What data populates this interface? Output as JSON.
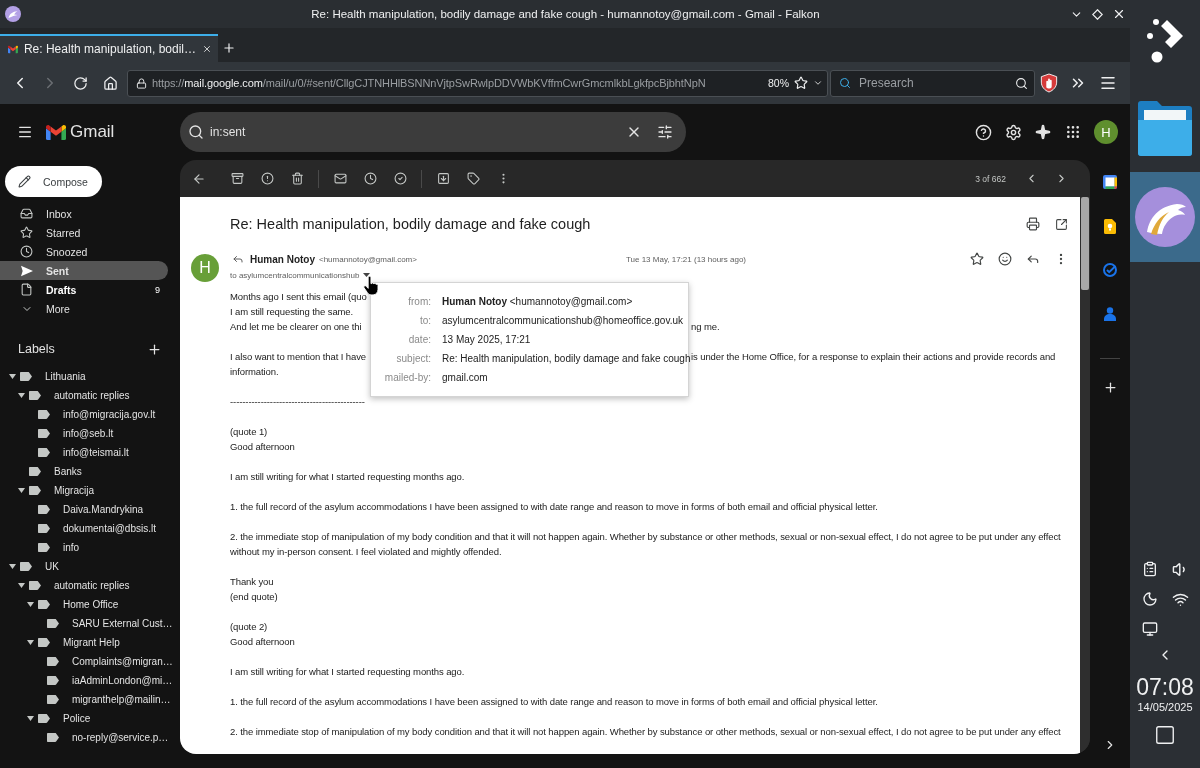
{
  "window": {
    "title": "Re: Health manipulation, bodily damage and fake cough - humannotoy@gmail.com - Gmail - Falkon"
  },
  "tabs": [
    {
      "label": "Re: Health manipulation, bodil…",
      "selected": true
    }
  ],
  "navigation": {
    "back_disabled": false,
    "forward_disabled": true,
    "url_scheme": "https://",
    "url_host": "mail.google.com",
    "url_path": "/mail/u/0/#sent/CllgCJTNHHlBSNNnVjtpSwRwlpDDVWbKVffmCwrGmcmlkbLgkfpcBjbhtNpN",
    "zoom": "80%",
    "search": {
      "placeholder": "Presearch"
    }
  },
  "gmail": {
    "brand": "Gmail",
    "search": {
      "value": "in:sent"
    },
    "account_initial": "H",
    "compose": "Compose",
    "nav": [
      {
        "label": "Inbox",
        "selected": false,
        "unread": false
      },
      {
        "label": "Starred",
        "selected": false,
        "unread": false
      },
      {
        "label": "Snoozed",
        "selected": false,
        "unread": false
      },
      {
        "label": "Sent",
        "selected": true,
        "unread": false
      },
      {
        "label": "Drafts",
        "selected": false,
        "unread": true,
        "count": "9"
      },
      {
        "label": "More",
        "selected": false,
        "unread": false
      }
    ],
    "labels_heading": "Labels",
    "labels": [
      {
        "label": "Lithuania",
        "expanded": true,
        "children": [
          {
            "label": "automatic replies",
            "expanded": true,
            "children": [
              {
                "label": "info@migracija.gov.lt"
              },
              {
                "label": "info@seb.lt"
              },
              {
                "label": "info@teismai.lt"
              }
            ]
          },
          {
            "label": "Banks"
          },
          {
            "label": "Migracija",
            "expanded": true,
            "children": [
              {
                "label": "Daiva.Mandrykina"
              },
              {
                "label": "dokumentai@dbsis.lt"
              },
              {
                "label": "info"
              }
            ]
          }
        ]
      },
      {
        "label": "UK",
        "expanded": true,
        "children": [
          {
            "label": "automatic replies",
            "expanded": true,
            "children": [
              {
                "label": "Home Office",
                "expanded": true,
                "children": [
                  {
                    "label": "SARU External Cust…"
                  }
                ]
              },
              {
                "label": "Migrant Help",
                "expanded": true,
                "children": [
                  {
                    "label": "Complaints@migran…"
                  },
                  {
                    "label": "iaAdminLondon@mi…"
                  },
                  {
                    "label": "migranthelp@mailin…"
                  }
                ]
              },
              {
                "label": "Police",
                "expanded": true,
                "children": [
                  {
                    "label": "no-reply@service.p…"
                  }
                ]
              }
            ]
          }
        ]
      }
    ],
    "toolbar": {
      "counter": "3 of 662"
    },
    "email": {
      "subject": "Re: Health manipulation, bodily damage and fake cough",
      "avatar_initial": "H",
      "sender_name": "Human Notoy",
      "sender_address": "<humannotoy@gmail.com>",
      "recipient": "to asylumcentralcommunicationshub",
      "date": "Tue 13 May, 17:21 (13 hours ago)",
      "starred": false,
      "details": [
        {
          "label": "from:",
          "value": "**Human Notoy** <humannotoy@gmail.com>"
        },
        {
          "label": "to:",
          "value": "asylumcentralcommunicationshub@homeoffice.gov.uk"
        },
        {
          "label": "date:",
          "value": "13 May 2025, 17:21"
        },
        {
          "label": "subject:",
          "value": "Re: Health manipulation, bodily damage and fake cough"
        },
        {
          "label": "mailed-by:",
          "value": "gmail.com"
        }
      ],
      "body": [
        {
          "lines": [
            {
              "kind": "covered",
              "left": "Months ago I sent this email (quo"
            },
            {
              "kind": "full",
              "text": "I am still requesting the same."
            },
            {
              "kind": "covered",
              "left": "And let me be clearer on one thi",
              "right": "ng me."
            }
          ]
        },
        {
          "lines": [
            {
              "kind": "covered",
              "left": "I also want to mention that I have",
              "right": "is under the Home Office, for a response to explain their actions and provide records and"
            },
            {
              "kind": "full",
              "text": "information."
            }
          ]
        },
        {
          "lines": [
            {
              "kind": "full",
              "text": "--------------------------------------------"
            }
          ]
        },
        {
          "lines": [
            {
              "kind": "full",
              "text": "(quote 1)"
            },
            {
              "kind": "full",
              "text": "Good afternoon"
            }
          ]
        },
        {
          "lines": [
            {
              "kind": "full",
              "text": "I am still writing for what I started requesting months ago."
            }
          ]
        },
        {
          "lines": [
            {
              "kind": "full",
              "text": "1. the full record of the asylum accommodations I have been assigned to with date range and reason to move in forms of both email and official physical letter."
            }
          ]
        },
        {
          "lines": [
            {
              "kind": "full",
              "text": "2. the immediate stop of manipulation of my body condition and that it will not happen again. Whether by substance or other methods, sexual or non-sexual effect, I do not agree to be put under any effect without my in-person consent. I feel violated and mightly offended."
            }
          ]
        },
        {
          "lines": [
            {
              "kind": "full",
              "text": "Thank you"
            },
            {
              "kind": "full",
              "text": "(end quote)"
            }
          ]
        },
        {
          "lines": [
            {
              "kind": "full",
              "text": "(quote 2)"
            },
            {
              "kind": "full",
              "text": "Good afternoon"
            }
          ]
        },
        {
          "lines": [
            {
              "kind": "full",
              "text": "I am still writing for what I started requesting months ago."
            }
          ]
        },
        {
          "lines": [
            {
              "kind": "full",
              "text": "1. the full record of the asylum accommodations I have been assigned to with date range and reason to move in forms of both email and official physical letter."
            }
          ]
        },
        {
          "lines": [
            {
              "kind": "full",
              "text": "2. the immediate stop of manipulation of my body condition and that it will not happen again. Whether by substance or other methods, sexual or non-sexual effect, I do not agree to be put under any effect"
            }
          ]
        }
      ]
    }
  },
  "taskbar": {
    "tasks": [
      {
        "selected": false
      },
      {
        "selected": true
      }
    ],
    "time": "07:08",
    "date": "14/05/2025"
  }
}
